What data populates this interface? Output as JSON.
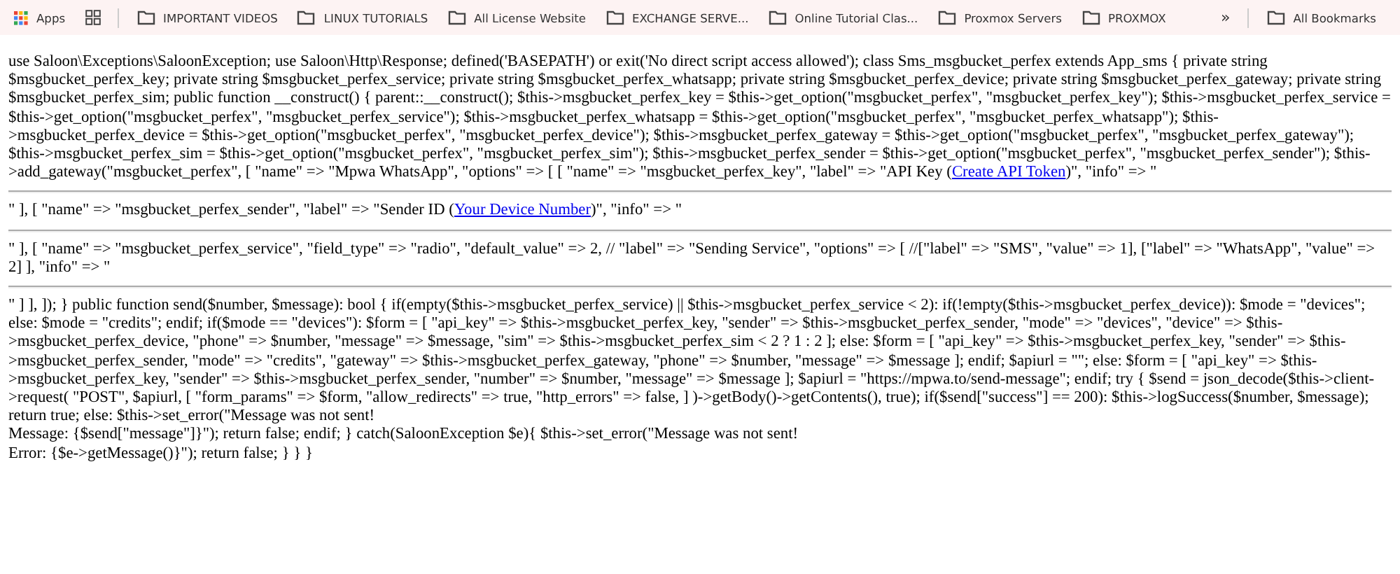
{
  "bookmarks_bar": {
    "apps_label": "Apps",
    "items": [
      {
        "kind": "folder",
        "label": "IMPORTANT VIDEOS"
      },
      {
        "kind": "folder",
        "label": "LINUX TUTORIALS"
      },
      {
        "kind": "folder",
        "label": "All License Website"
      },
      {
        "kind": "folder",
        "label": "EXCHANGE SERVE..."
      },
      {
        "kind": "folder",
        "label": "Online Tutorial Clas..."
      },
      {
        "kind": "folder",
        "label": "Proxmox Servers"
      },
      {
        "kind": "folder",
        "label": "PROXMOX"
      }
    ],
    "overflow": "»",
    "all_bookmarks": "All Bookmarks"
  },
  "page_blocks": [
    {
      "segments": [
        {
          "kind": "text",
          "text": "use Saloon\\Exceptions\\SaloonException; use Saloon\\Http\\Response; defined('BASEPATH') or exit('No direct script access allowed'); class Sms_msgbucket_perfex extends App_sms { private string $msgbucket_perfex_key; private string $msgbucket_perfex_service; private string $msgbucket_perfex_whatsapp; private string $msgbucket_perfex_device; private string $msgbucket_perfex_gateway; private string $msgbucket_perfex_sim; public function __construct() { parent::__construct(); $this->msgbucket_perfex_key = $this->get_option(\"msgbucket_perfex\", \"msgbucket_perfex_key\"); $this->msgbucket_perfex_service = $this->get_option(\"msgbucket_perfex\", \"msgbucket_perfex_service\"); $this->msgbucket_perfex_whatsapp = $this->get_option(\"msgbucket_perfex\", \"msgbucket_perfex_whatsapp\"); $this->msgbucket_perfex_device = $this->get_option(\"msgbucket_perfex\", \"msgbucket_perfex_device\"); $this->msgbucket_perfex_gateway = $this->get_option(\"msgbucket_perfex\", \"msgbucket_perfex_gateway\"); $this->msgbucket_perfex_sim = $this->get_option(\"msgbucket_perfex\", \"msgbucket_perfex_sim\"); $this->msgbucket_perfex_sender = $this->get_option(\"msgbucket_perfex\", \"msgbucket_perfex_sender\"); $this->add_gateway(\"msgbucket_perfex\", [ \"name\" => \"Mpwa WhatsApp\", \"options\" => [ [ \"name\" => \"msgbucket_perfex_key\", \"label\" => \"API Key ("
        },
        {
          "kind": "link",
          "text": "Create API Token"
        },
        {
          "kind": "text",
          "text": ")\", \"info\" => \""
        }
      ]
    },
    {
      "segments": [
        {
          "kind": "text",
          "text": "\" ], [ \"name\" => \"msgbucket_perfex_sender\", \"label\" => \"Sender ID ("
        },
        {
          "kind": "link",
          "text": "Your Device Number"
        },
        {
          "kind": "text",
          "text": ")\", \"info\" => \""
        }
      ]
    },
    {
      "segments": [
        {
          "kind": "text",
          "text": "\" ], [ \"name\" => \"msgbucket_perfex_service\", \"field_type\" => \"radio\", \"default_value\" => 2, // \"label\" => \"Sending Service\", \"options\" => [ //[\"label\" => \"SMS\", \"value\" => 1], [\"label\" => \"WhatsApp\", \"value\" => 2] ], \"info\" => \""
        }
      ]
    },
    {
      "segments": [
        {
          "kind": "text",
          "text": "\" ] ], ]); } public function send($number, $message): bool { if(empty($this->msgbucket_perfex_service) || $this->msgbucket_perfex_service < 2): if(!empty($this->msgbucket_perfex_device)): $mode = \"devices\"; else: $mode = \"credits\"; endif; if($mode == \"devices\"): $form = [ \"api_key\" => $this->msgbucket_perfex_key, \"sender\" => $this->msgbucket_perfex_sender, \"mode\" => \"devices\", \"device\" => $this->msgbucket_perfex_device, \"phone\" => $number, \"message\" => $message, \"sim\" => $this->msgbucket_perfex_sim < 2 ? 1 : 2 ]; else: $form = [ \"api_key\" => $this->msgbucket_perfex_key, \"sender\" => $this->msgbucket_perfex_sender, \"mode\" => \"credits\", \"gateway\" => $this->msgbucket_perfex_gateway, \"phone\" => $number, \"message\" => $message ]; endif; $apiurl = \"\"; else: $form = [ \"api_key\" => $this->msgbucket_perfex_key, \"sender\" => $this->msgbucket_perfex_sender, \"number\" => $number, \"message\" => $message ]; $apiurl = \"https://mpwa.to/send-message\"; endif; try { $send = json_decode($this->client->request( \"POST\", $apiurl, [ \"form_params\" => $form, \"allow_redirects\" => true, \"http_errors\" => false, ] )->getBody()->getContents(), true); if($send[\"success\"] == 200): $this->logSuccess($number, $message); return true; else: $this->set_error(\"Message was not sent!\nMessage: {$send[\"message\"]}\"); return false; endif; } catch(SaloonException $e){ $this->set_error(\"Message was not sent!\nError: {$e->getMessage()}\"); return false; } } }"
        }
      ]
    }
  ]
}
